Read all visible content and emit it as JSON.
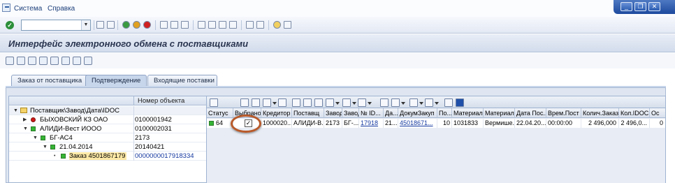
{
  "menu": {
    "items": [
      "Система",
      "Справка"
    ]
  },
  "window": {
    "minimize": "_",
    "restore": "❐",
    "close": "✕"
  },
  "title": "Интерфейс электронного обмена с поставщиками",
  "tabs": [
    "Заказ от поставщика",
    "Подтверждение",
    "Входящие поставки"
  ],
  "active_tab": 1,
  "tree": {
    "col2_header": "Номер объекта",
    "rows": [
      {
        "label": "Поставщик\\Завод\\Дата\\IDOC",
        "value": ""
      },
      {
        "label": "БЫХОВСКИЙ КЗ ОАО",
        "value": "0100001942"
      },
      {
        "label": "АЛИДИ-Вест ИООО",
        "value": "0100002031"
      },
      {
        "label": "БГ-АС4",
        "value": "2173"
      },
      {
        "label": "21.04.2014",
        "value": "20140421"
      },
      {
        "label": "Заказ 4501867179",
        "value": "0000000017918334"
      }
    ]
  },
  "grid": {
    "columns": [
      "Статус",
      "Выбрано",
      "Кредитор",
      "Поставщ",
      "Завод",
      "Завод",
      "№ ID...",
      "Да...",
      "ДокумЗакуп",
      "По...",
      "Материал",
      "Материал",
      "Дата Пос...",
      "Врем.Пост",
      "Колич.Заказ",
      "Кол.IDOC",
      "Ос"
    ],
    "rows": [
      [
        "64",
        "✓",
        "1000020...",
        "АЛИДИ-В...",
        "2173",
        "БГ-...",
        "17918",
        "21...",
        "45018671...",
        "10",
        "1031833",
        "Вермише...",
        "22.04.20...",
        "00:00:00",
        "2 496,000",
        "2 496,0...",
        "0"
      ]
    ]
  },
  "colors": {
    "status_green": "#35b535",
    "status_red": "#d01818",
    "selected_row": "#fde9a6",
    "annotation_ring": "#b85a2a"
  }
}
